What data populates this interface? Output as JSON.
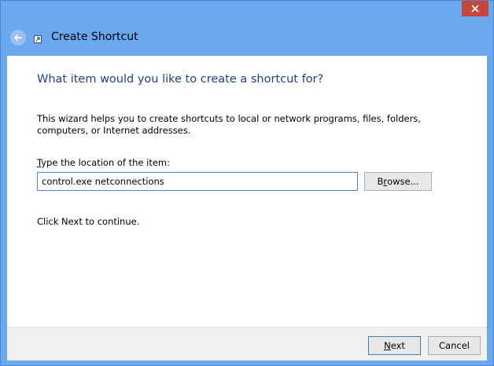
{
  "window": {
    "title": "Create Shortcut"
  },
  "wizard": {
    "heading": "What item would you like to create a shortcut for?",
    "description": "This wizard helps you to create shortcuts to local or network programs, files, folders, computers, or Internet addresses.",
    "location_label_accel": "T",
    "location_label_rest": "ype the location of the item:",
    "location_value": "control.exe netconnections",
    "browse_accel": "r",
    "browse_label_pre": "B",
    "browse_label_post": "owse...",
    "continue_text": "Click Next to continue."
  },
  "footer": {
    "next_accel": "N",
    "next_label_rest": "ext",
    "cancel_label": "Cancel"
  },
  "icons": {
    "close": "close-icon",
    "back": "back-arrow-icon",
    "shortcut": "shortcut-icon"
  },
  "colors": {
    "frame": "#6aa8f0",
    "close_button": "#c7463a",
    "heading": "#1f3f8f",
    "input_border": "#4a86cf"
  }
}
